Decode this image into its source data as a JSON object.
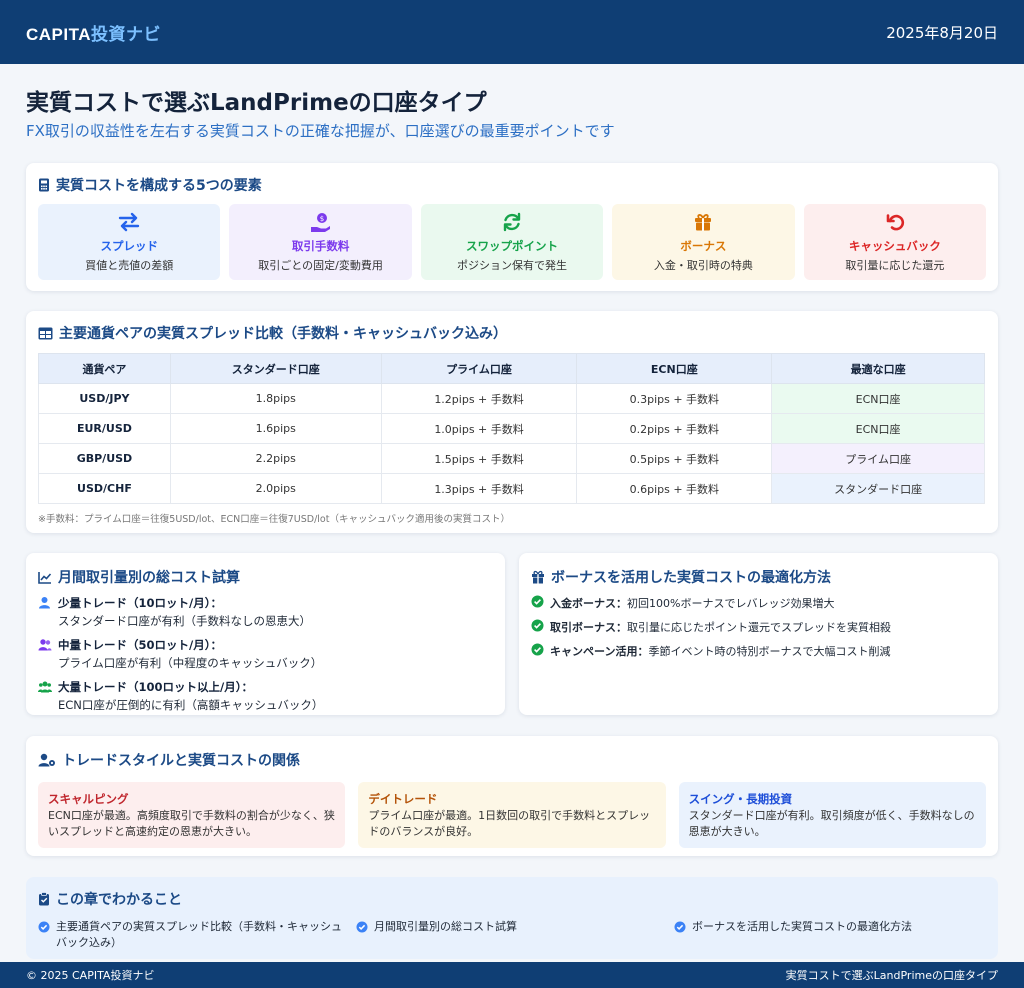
{
  "header": {
    "brand_prefix": "CAPITA",
    "brand_accent": "投資ナビ",
    "date": "2025年8月20日"
  },
  "hero": {
    "title": "実質コストで選ぶLandPrimeの口座タイプ",
    "subtitle": "FX取引の収益性を左右する実質コストの正確な把握が、口座選びの最重要ポイントです"
  },
  "factors_section": {
    "title": "実質コストを構成する5つの要素",
    "items": [
      {
        "name": "スプレッド",
        "desc": "買値と売値の差額",
        "icon": "exchange-arrows-icon",
        "color": "#2563eb",
        "bg": "#eaf2fd"
      },
      {
        "name": "取引手数料",
        "desc": "取引ごとの固定/変動費用",
        "icon": "hand-coin-icon",
        "color": "#7c3aed",
        "bg": "#f3effd"
      },
      {
        "name": "スワップポイント",
        "desc": "ポジション保有で発生",
        "icon": "sync-icon",
        "color": "#16a34a",
        "bg": "#eaf9ef"
      },
      {
        "name": "ボーナス",
        "desc": "入金・取引時の特典",
        "icon": "gift-icon",
        "color": "#d97706",
        "bg": "#fdf7e6"
      },
      {
        "name": "キャッシュバック",
        "desc": "取引量に応じた還元",
        "icon": "undo-icon",
        "color": "#dc2626",
        "bg": "#fdeeee"
      }
    ]
  },
  "spread_table": {
    "title": "主要通貨ペアの実質スプレッド比較（手数料・キャッシュバック込み）",
    "headers": [
      "通貨ペア",
      "スタンダード口座",
      "プライム口座",
      "ECN口座",
      "最適な口座"
    ],
    "rows": [
      [
        "USD/JPY",
        "1.8pips",
        "1.2pips + 手数料",
        "0.3pips + 手数料",
        "ECN口座"
      ],
      [
        "EUR/USD",
        "1.6pips",
        "1.0pips + 手数料",
        "0.2pips + 手数料",
        "ECN口座"
      ],
      [
        "GBP/USD",
        "2.2pips",
        "1.5pips + 手数料",
        "0.5pips + 手数料",
        "プライム口座"
      ],
      [
        "USD/CHF",
        "2.0pips",
        "1.3pips + 手数料",
        "0.6pips + 手数料",
        "スタンダード口座"
      ]
    ],
    "best_colors": [
      "#eafaf0",
      "#eafaf0",
      "#f4f0fd",
      "#eaf2fd"
    ],
    "note": "※手数料：プライム口座＝往復5USD/lot、ECN口座＝往復7USD/lot（キャッシュバック適用後の実質コスト）"
  },
  "monthly": {
    "title": "月間取引量別の総コスト試算",
    "items": [
      {
        "head": "少量トレード（10ロット/月）：",
        "body": "スタンダード口座が有利（手数料なしの恩恵大）",
        "icon": "user-icon"
      },
      {
        "head": "中量トレード（50ロット/月）：",
        "body": "プライム口座が有利（中程度のキャッシュバック）",
        "icon": "user-pair-icon"
      },
      {
        "head": "大量トレード（100ロット以上/月）：",
        "body": "ECN口座が圧倒的に有利（高額キャッシュバック）",
        "icon": "users-group-icon"
      }
    ]
  },
  "bonus": {
    "title": "ボーナスを活用した実質コストの最適化方法",
    "items": [
      {
        "head": "入金ボーナス：",
        "body": "初回100%ボーナスでレバレッジ効果増大"
      },
      {
        "head": "取引ボーナス：",
        "body": "取引量に応じたポイント還元でスプレッドを実質相殺"
      },
      {
        "head": "キャンペーン活用：",
        "body": "季節イベント時の特別ボーナスで大幅コスト削減"
      }
    ]
  },
  "styles_section": {
    "title": "トレードスタイルと実質コストの関係",
    "items": [
      {
        "name": "スキャルピング",
        "desc": "ECN口座が最適。高頻度取引で手数料の割合が少なく、狭いスプレッドと高速約定の恩恵が大きい。",
        "color": "#c0262d",
        "bg": "#fdeeee"
      },
      {
        "name": "デイトレード",
        "desc": "プライム口座が最適。1日数回の取引で手数料とスプレッドのバランスが良好。",
        "color": "#b45309",
        "bg": "#fdf7e6"
      },
      {
        "name": "スイング・長期投資",
        "desc": "スタンダード口座が有利。取引頻度が低く、手数料なしの恩恵が大きい。",
        "color": "#1d4ed8",
        "bg": "#eaf2fd"
      }
    ]
  },
  "learn": {
    "title": "この章でわかること",
    "items": [
      "主要通貨ペアの実質スプレッド比較（手数料・キャッシュバック込み）",
      "月間取引量別の総コスト試算",
      "ボーナスを活用した実質コストの最適化方法"
    ]
  },
  "footer": {
    "copyright": "© 2025 CAPITA投資ナビ",
    "right": "実質コストで選ぶLandPrimeの口座タイプ"
  }
}
